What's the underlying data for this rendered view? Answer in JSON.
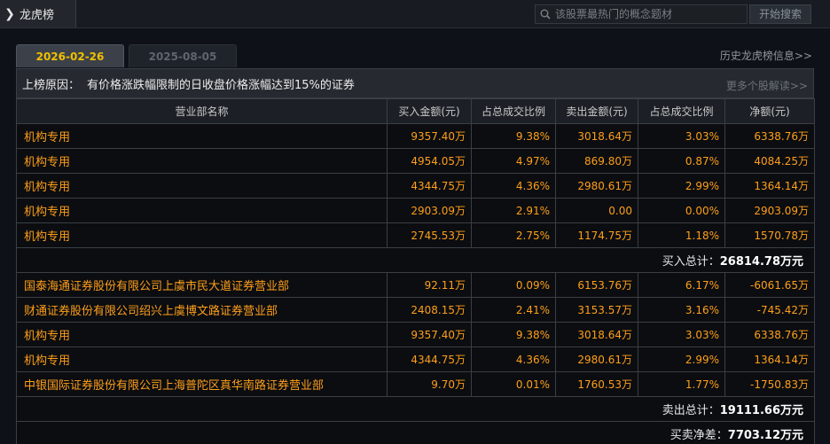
{
  "header": {
    "title": "龙虎榜",
    "search_placeholder": "该股票最热门的概念题材",
    "search_button": "开始搜索"
  },
  "date_tabs": [
    "2026-02-26",
    "2025-08-05"
  ],
  "history_link": "历史龙虎榜信息>>",
  "reason": {
    "label": "上榜原因：",
    "text": "有价格涨跌幅限制的日收盘价格涨幅达到15%的证券",
    "more_link": "更多个股解读>>"
  },
  "table": {
    "columns": [
      "营业部名称",
      "买入金额(元)",
      "占总成交比例",
      "卖出金额(元)",
      "占总成交比例",
      "净额(元)"
    ],
    "buy_rows": [
      [
        "机构专用",
        "9357.40万",
        "9.38%",
        "3018.64万",
        "3.03%",
        "6338.76万"
      ],
      [
        "机构专用",
        "4954.05万",
        "4.97%",
        "869.80万",
        "0.87%",
        "4084.25万"
      ],
      [
        "机构专用",
        "4344.75万",
        "4.36%",
        "2980.61万",
        "2.99%",
        "1364.14万"
      ],
      [
        "机构专用",
        "2903.09万",
        "2.91%",
        "0.00",
        "0.00%",
        "2903.09万"
      ],
      [
        "机构专用",
        "2745.53万",
        "2.75%",
        "1174.75万",
        "1.18%",
        "1570.78万"
      ]
    ],
    "buy_total_label": "买入总计：",
    "buy_total_value": "26814.78万元",
    "sell_rows": [
      [
        "国泰海通证券股份有限公司上虞市民大道证券营业部",
        "92.11万",
        "0.09%",
        "6153.76万",
        "6.17%",
        "-6061.65万"
      ],
      [
        "财通证券股份有限公司绍兴上虞博文路证券营业部",
        "2408.15万",
        "2.41%",
        "3153.57万",
        "3.16%",
        "-745.42万"
      ],
      [
        "机构专用",
        "9357.40万",
        "9.38%",
        "3018.64万",
        "3.03%",
        "6338.76万"
      ],
      [
        "机构专用",
        "4344.75万",
        "4.36%",
        "2980.61万",
        "2.99%",
        "1364.14万"
      ],
      [
        "中银国际证券股份有限公司上海普陀区真华南路证券营业部",
        "9.70万",
        "0.01%",
        "1760.53万",
        "1.77%",
        "-1750.83万"
      ]
    ],
    "sell_total_label": "卖出总计：",
    "sell_total_value": "19111.66万元",
    "net_label": "买卖净差：",
    "net_value": "7703.12万元"
  }
}
